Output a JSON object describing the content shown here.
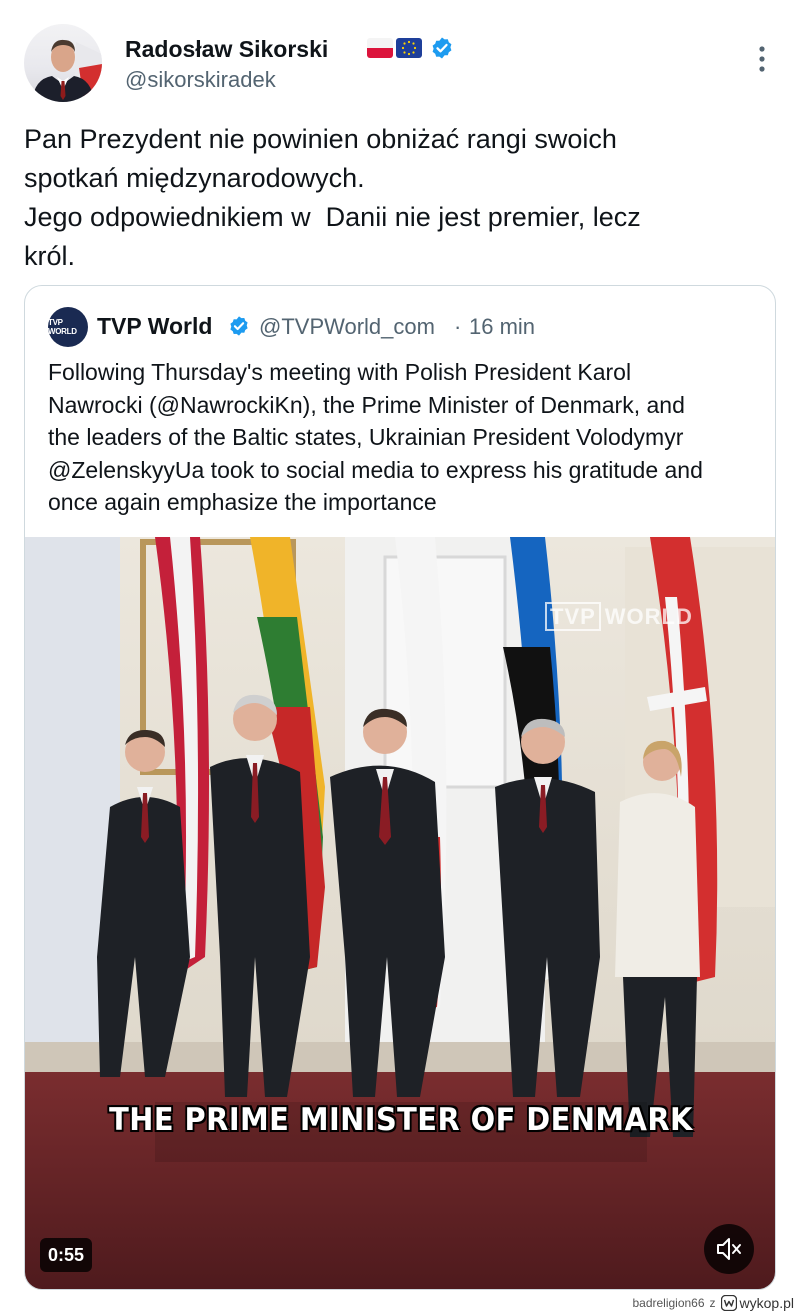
{
  "tweet": {
    "author_name": "Radosław Sikorski",
    "author_handle": "@sikorskiradek",
    "flags": [
      "poland-flag-emoji",
      "eu-flag-emoji"
    ],
    "text_lines": [
      "Pan Prezydent nie powinien obniżać rangi swoich",
      "spotkań międzynarodowych.",
      "Jego odpowiednikiem w  Danii nie jest premier, lecz",
      "król."
    ]
  },
  "quote": {
    "author_name": "TVP World",
    "author_handle": "@TVPWorld_com",
    "separator": "·",
    "time": "16 min",
    "avatar_text": "TVP WORLD",
    "text_lines": [
      "Following Thursday's meeting with Polish President Karol",
      "Nawrocki (@NawrockiKn), the Prime Minister of Denmark, and",
      "the leaders of the Baltic states, Ukrainian President Volodymyr",
      "@ZelenskyyUa took to social media to express his gratitude and",
      "once again emphasize the importance"
    ],
    "video": {
      "watermark_tvp": "TVP",
      "watermark_world": "WORLD",
      "caption": "THE PRIME MINISTER OF DENMARK",
      "duration": "0:55",
      "muted": true
    }
  },
  "footer": {
    "user": "badreligion66",
    "connector": "z",
    "site": "wykop.pl"
  },
  "colors": {
    "verified_blue": "#1d9bf0",
    "text": "#0f1419",
    "secondary": "#536471",
    "border": "#cfd9de"
  }
}
